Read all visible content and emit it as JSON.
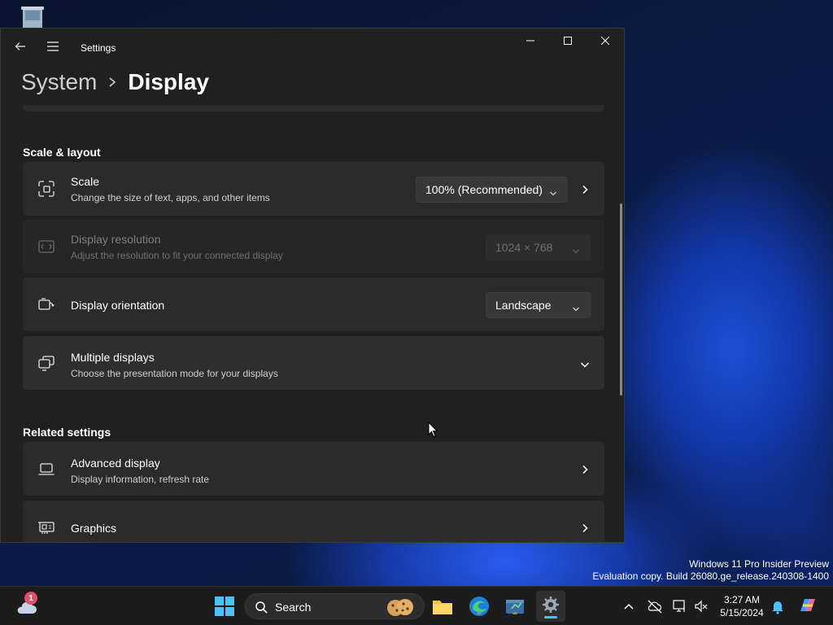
{
  "window": {
    "app_title": "Settings",
    "breadcrumb": {
      "parent": "System",
      "current": "Display"
    }
  },
  "sections": {
    "scale_layout": "Scale & layout",
    "related": "Related settings"
  },
  "rows": {
    "scale": {
      "label": "Scale",
      "sub": "Change the size of text, apps, and other items",
      "value": "100% (Recommended)"
    },
    "resolution": {
      "label": "Display resolution",
      "sub": "Adjust the resolution to fit your connected display",
      "value": "1024 × 768"
    },
    "orientation": {
      "label": "Display orientation",
      "value": "Landscape"
    },
    "multiple": {
      "label": "Multiple displays",
      "sub": "Choose the presentation mode for your displays"
    },
    "advanced": {
      "label": "Advanced display",
      "sub": "Display information, refresh rate"
    },
    "graphics": {
      "label": "Graphics"
    }
  },
  "taskbar": {
    "search_label": "Search",
    "weather_badge": "1",
    "time": "3:27 AM",
    "date": "5/15/2024"
  },
  "watermark": {
    "line1": "Windows 11 Pro Insider Preview",
    "line2": "Evaluation copy. Build 26080.ge_release.240308-1400"
  },
  "colors": {
    "window_bg": "#202020",
    "card_bg": "#2b2b2b",
    "accent": "#4cc2ff"
  }
}
